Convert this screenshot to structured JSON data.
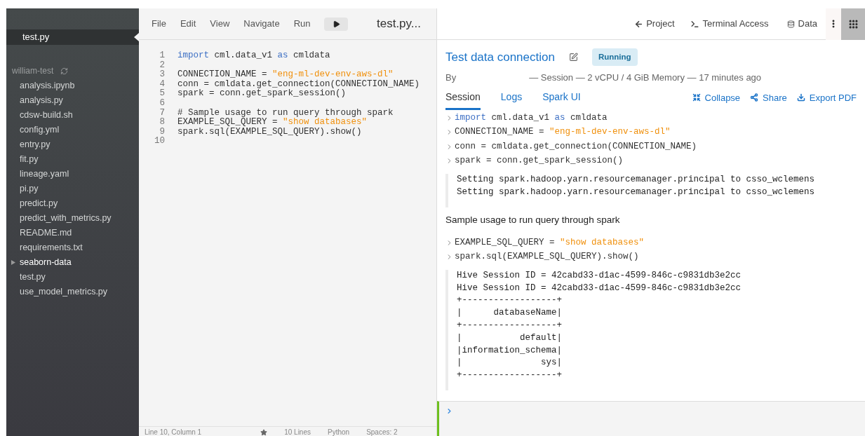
{
  "sidebar": {
    "open_tabs": [
      {
        "label": "test.py",
        "selected": true
      }
    ],
    "project": "william-test",
    "files": [
      {
        "name": "analysis.ipynb",
        "kind": "file"
      },
      {
        "name": "analysis.py",
        "kind": "file"
      },
      {
        "name": "cdsw-build.sh",
        "kind": "file"
      },
      {
        "name": "config.yml",
        "kind": "file"
      },
      {
        "name": "entry.py",
        "kind": "file"
      },
      {
        "name": "fit.py",
        "kind": "file"
      },
      {
        "name": "lineage.yaml",
        "kind": "file"
      },
      {
        "name": "pi.py",
        "kind": "file"
      },
      {
        "name": "predict.py",
        "kind": "file"
      },
      {
        "name": "predict_with_metrics.py",
        "kind": "file"
      },
      {
        "name": "README.md",
        "kind": "file"
      },
      {
        "name": "requirements.txt",
        "kind": "file"
      },
      {
        "name": "seaborn-data",
        "kind": "folder",
        "expanded": false
      },
      {
        "name": "test.py",
        "kind": "file"
      },
      {
        "name": "use_model_metrics.py",
        "kind": "file"
      }
    ]
  },
  "editor": {
    "menu": [
      "File",
      "Edit",
      "View",
      "Navigate",
      "Run"
    ],
    "file_title": "test.py...",
    "lines": [
      {
        "number": "1",
        "tokens": [
          {
            "kind": "keyword",
            "text": "import"
          },
          {
            "kind": "plain",
            "text": " cml.data_v1 "
          },
          {
            "kind": "keyword",
            "text": "as"
          },
          {
            "kind": "plain",
            "text": " cmldata"
          }
        ]
      },
      {
        "number": "2"
      },
      {
        "number": "3",
        "tokens": [
          {
            "kind": "plain",
            "text": "CONNECTION_NAME = "
          },
          {
            "kind": "string",
            "text": "\"eng-ml-dev-env-aws-dl\""
          }
        ]
      },
      {
        "number": "4",
        "tokens": [
          {
            "kind": "plain",
            "text": "conn = cmldata.get_connection(CONNECTION_NAME)"
          }
        ]
      },
      {
        "number": "5",
        "tokens": [
          {
            "kind": "plain",
            "text": "spark = conn.get_spark_session()"
          }
        ]
      },
      {
        "number": "6"
      },
      {
        "number": "7",
        "tokens": [
          {
            "kind": "plain",
            "text": "# Sample usage to run query through spark"
          }
        ]
      },
      {
        "number": "8",
        "tokens": [
          {
            "kind": "plain",
            "text": "EXAMPLE_SQL_QUERY = "
          },
          {
            "kind": "string",
            "text": "\"show databases\""
          }
        ]
      },
      {
        "number": "9",
        "tokens": [
          {
            "kind": "plain",
            "text": "spark.sql(EXAMPLE_SQL_QUERY).show()"
          }
        ]
      },
      {
        "number": "10"
      }
    ],
    "status_bar": {
      "position": "Line 10, Column 1",
      "lines": "10 Lines",
      "language": "Python",
      "indent": "Spaces: 2"
    }
  },
  "toolbar": {
    "project": "Project",
    "terminal": "Terminal Access",
    "data": "Data"
  },
  "session": {
    "title": "Test data connection",
    "status": "Running",
    "by": "By",
    "meta": "— Session — 2 vCPU / 4 GiB Memory — 17 minutes ago",
    "tabs": [
      {
        "label": "Session",
        "selected": true
      },
      {
        "label": "Logs",
        "selected": false
      },
      {
        "label": "Spark UI",
        "selected": false
      }
    ],
    "actions": {
      "collapse": "Collapse",
      "share": "Share",
      "export": "Export PDF"
    },
    "blocks": [
      {
        "kind": "input",
        "tokens": [
          {
            "kind": "keyword",
            "text": "import"
          },
          {
            "kind": "plain",
            "text": " cml.data_v1 "
          },
          {
            "kind": "keyword",
            "text": "as"
          },
          {
            "kind": "plain",
            "text": " cmldata"
          }
        ]
      },
      {
        "kind": "input",
        "tokens": [
          {
            "kind": "plain",
            "text": "CONNECTION_NAME = "
          },
          {
            "kind": "string",
            "text": "\"eng-ml-dev-env-aws-dl\""
          }
        ]
      },
      {
        "kind": "input",
        "tokens": [
          {
            "kind": "plain",
            "text": "conn = cmldata.get_connection(CONNECTION_NAME)"
          }
        ]
      },
      {
        "kind": "input",
        "tokens": [
          {
            "kind": "plain",
            "text": "spark = conn.get_spark_session()"
          }
        ]
      },
      {
        "kind": "output",
        "lines": [
          "Setting spark.hadoop.yarn.resourcemanager.principal to csso_wclemens",
          "Setting spark.hadoop.yarn.resourcemanager.principal to csso_wclemens"
        ]
      },
      {
        "kind": "markdown",
        "text": "Sample usage to run query through spark"
      },
      {
        "kind": "input",
        "tokens": [
          {
            "kind": "plain",
            "text": "EXAMPLE_SQL_QUERY = "
          },
          {
            "kind": "string",
            "text": "\"show databases\""
          }
        ]
      },
      {
        "kind": "input",
        "tokens": [
          {
            "kind": "plain",
            "text": "spark.sql(EXAMPLE_SQL_QUERY).show()"
          }
        ]
      },
      {
        "kind": "output",
        "lines": [
          "Hive Session ID = 42cabd33-d1ac-4599-846c-c9831db3e2cc",
          "Hive Session ID = 42cabd33-d1ac-4599-846c-c9831db3e2cc",
          "+------------------+",
          "|      databaseName|",
          "+------------------+",
          "|           default|",
          "|information_schema|",
          "|               sys|",
          "+------------------+"
        ]
      }
    ]
  }
}
